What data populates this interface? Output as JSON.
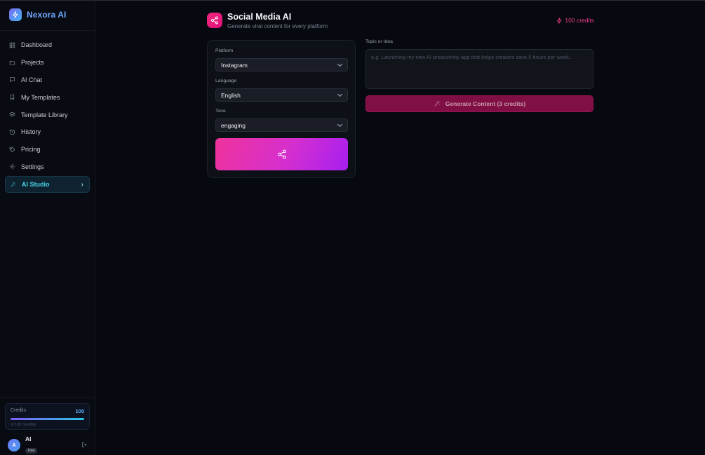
{
  "brand": {
    "name": "Nexora AI"
  },
  "sidebar": {
    "items": [
      {
        "label": "Dashboard",
        "icon": "dashboard-icon"
      },
      {
        "label": "Projects",
        "icon": "folder-icon"
      },
      {
        "label": "AI Chat",
        "icon": "chat-icon"
      },
      {
        "label": "My Templates",
        "icon": "bookmark-icon"
      },
      {
        "label": "Template Library",
        "icon": "layers-icon"
      },
      {
        "label": "History",
        "icon": "history-icon"
      },
      {
        "label": "Pricing",
        "icon": "tag-icon"
      },
      {
        "label": "Settings",
        "icon": "gear-icon"
      },
      {
        "label": "AI Studio",
        "icon": "wand-icon",
        "active": true
      }
    ],
    "credits": {
      "label": "Credits",
      "value": "100",
      "sub": "of 100 monthly",
      "fraction": 1.0
    },
    "user": {
      "initial": "A",
      "name": "Al",
      "plan": "free"
    }
  },
  "header": {
    "title": "Social Media AI",
    "subtitle": "Generate viral content for every platform",
    "credits": "100 credits"
  },
  "form": {
    "platform_label": "Platform",
    "platform_value": "Instagram",
    "language_label": "Language",
    "language_value": "English",
    "tone_label": "Tone",
    "tone_value": "engaging",
    "topic_label": "Topic or Idea",
    "topic_placeholder": "e.g. Launching my new AI productivity app that helps creators save 5 hours per week...",
    "generate_label": "Generate Content (3 credits)"
  },
  "colors": {
    "accent_pink": "#ef3c8a",
    "accent_cyan": "#46d3e6",
    "brand_blue": "#6ea8ff",
    "background": "#070910"
  }
}
